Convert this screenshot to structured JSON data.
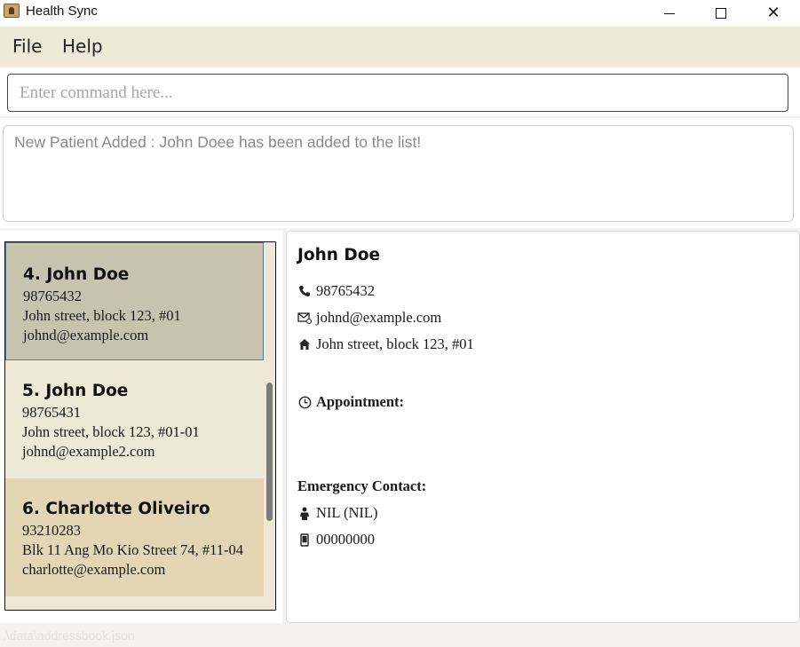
{
  "window": {
    "title": "Health Sync"
  },
  "menu": {
    "file": "File",
    "help": "Help"
  },
  "command": {
    "placeholder": "Enter command here...",
    "value": ""
  },
  "result": {
    "message": "New Patient Added : John Doee has been added to the list!"
  },
  "patient_list": {
    "cards": [
      {
        "index_name": "4. John Doe",
        "phone": "98765432",
        "address": "John street, block 123, #01",
        "email": "johnd@example.com",
        "selected": true
      },
      {
        "index_name": "5. John Doe",
        "phone": "98765431",
        "address": "John street, block 123, #01-01",
        "email": "johnd@example2.com",
        "selected": false
      },
      {
        "index_name": "6. Charlotte Oliveiro",
        "phone": "93210283",
        "address": "Blk 11 Ang Mo Kio Street 74, #11-04",
        "email": "charlotte@example.com",
        "selected": false
      }
    ]
  },
  "detail": {
    "name": "John Doe",
    "phone": "98765432",
    "email": "johnd@example.com",
    "address": "John street, block 123, #01",
    "appointment_label": "Appointment:",
    "emergency_label": "Emergency Contact:",
    "emergency_name": "NIL (NIL)",
    "emergency_phone": "00000000"
  },
  "status": {
    "file_path": ".\\data\\addressbook.json"
  },
  "icons": {
    "phone": "phone-icon",
    "email": "email-icon",
    "address": "home-icon",
    "appointment": "clock-icon",
    "emergency_name": "person-icon",
    "emergency_phone": "mobile-icon"
  },
  "colors": {
    "menu_bg": "#ede9d6",
    "selected_card": "#c8c3ae",
    "highlight_card": "#e4d6b5"
  }
}
